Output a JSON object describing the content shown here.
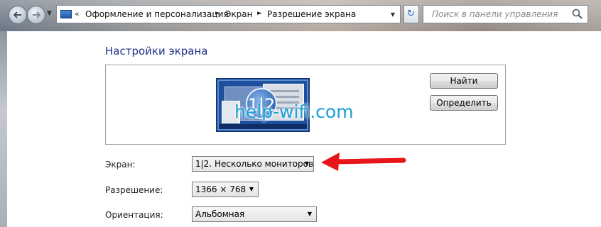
{
  "address_bar": {
    "breadcrumbs": [
      "Оформление и персонализация",
      "Экран",
      "Разрешение экрана"
    ]
  },
  "search": {
    "placeholder": "Поиск в панели управления"
  },
  "page": {
    "title": "Настройки экрана"
  },
  "preview": {
    "monitor_badge": "1|2",
    "watermark": "help-wifi.com"
  },
  "buttons": {
    "find": "Найти",
    "identify": "Определить"
  },
  "fields": {
    "screen": {
      "label": "Экран:",
      "value": "1|2. Несколько мониторов"
    },
    "resolution": {
      "label": "Разрешение:",
      "value": "1366 × 768"
    },
    "orientation": {
      "label": "Ориентация:",
      "value": "Альбомная"
    }
  },
  "colors": {
    "title_blue": "#1e3287",
    "annotation_arrow": "#e8161b",
    "watermark": "#1a9fd6"
  },
  "icons": [
    "back-arrow-icon",
    "forward-arrow-icon",
    "control-panel-icon",
    "refresh-icon",
    "search-icon",
    "dropdown-arrow-icon"
  ]
}
